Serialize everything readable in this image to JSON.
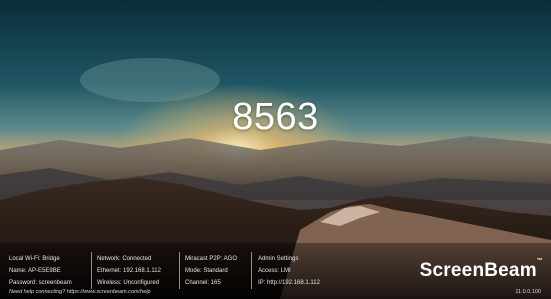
{
  "pin": "8563",
  "info": {
    "col1": [
      "Local Wi-Fi: Bridge",
      "Name: AP-E5E9BE",
      "Password: screenbeam"
    ],
    "col2": [
      "Network: Connected",
      "Ethernet: 192.168.1.112",
      "Wireless: Unconfigured"
    ],
    "col3": [
      "Miracast P2P: AGO",
      "Mode: Standard",
      "Channel: 165"
    ],
    "col4": [
      "Admin Settings",
      "Access: LMI",
      "IP: http://192.168.1.112"
    ]
  },
  "brand": {
    "name": "ScreenBeam",
    "tm": "™"
  },
  "footer": {
    "help": "Need help connecting? https://www.screenbeam.com/help",
    "version": "11.0.0.100"
  },
  "colors": {
    "sky_top": "#0f3a4a",
    "horizon": "#f2b35a",
    "mountain": "#1b1410"
  }
}
